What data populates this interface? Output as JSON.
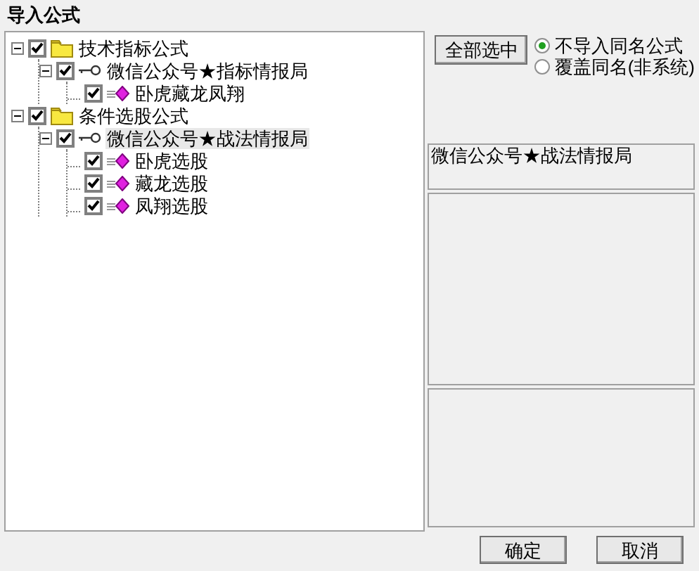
{
  "window": {
    "title": "导入公式"
  },
  "tree": [
    {
      "label": "技术指标公式",
      "kind": "folder",
      "checked": true,
      "expanded": true,
      "selected": false,
      "children": [
        {
          "label": "微信公众号★指标情报局",
          "kind": "group",
          "checked": true,
          "expanded": true,
          "selected": false,
          "children": [
            {
              "label": "卧虎藏龙凤翔",
              "kind": "formula",
              "checked": true,
              "selected": false
            }
          ]
        }
      ]
    },
    {
      "label": "条件选股公式",
      "kind": "folder",
      "checked": true,
      "expanded": true,
      "selected": false,
      "children": [
        {
          "label": "微信公众号★战法情报局",
          "kind": "group",
          "checked": true,
          "expanded": true,
          "selected": true,
          "children": [
            {
              "label": "卧虎选股",
              "kind": "formula",
              "checked": true,
              "selected": false
            },
            {
              "label": "藏龙选股",
              "kind": "formula",
              "checked": true,
              "selected": false
            },
            {
              "label": "凤翔选股",
              "kind": "formula",
              "checked": true,
              "selected": false
            }
          ]
        }
      ]
    }
  ],
  "select_all_button": "全部选中",
  "options": [
    {
      "label": "不导入同名公式",
      "selected": true
    },
    {
      "label": "覆盖同名(非系统)",
      "selected": false
    }
  ],
  "name_box": {
    "value": "微信公众号★战法情报局"
  },
  "buttons": [
    "确定",
    "取消"
  ]
}
